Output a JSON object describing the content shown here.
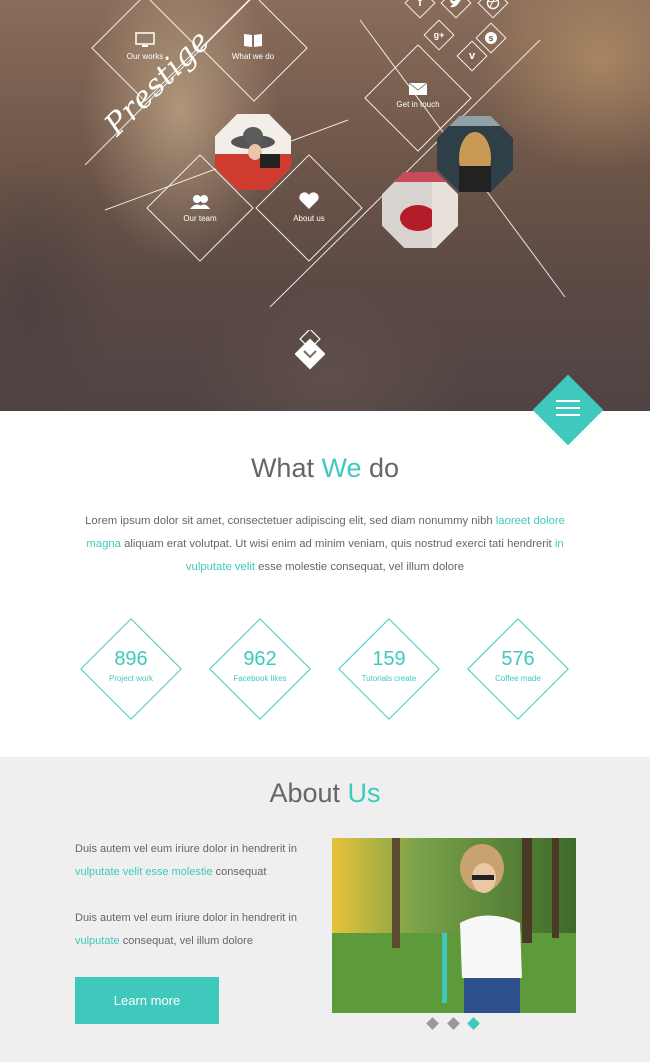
{
  "hero": {
    "brand": "Prestige",
    "tiles": {
      "works": "Our works",
      "what": "What we do",
      "team": "Our team",
      "about": "About us",
      "contact": "Get in touch"
    },
    "social": [
      "facebook-icon",
      "twitter-icon",
      "dribbble-icon",
      "google-plus-icon",
      "skype-icon",
      "vimeo-icon"
    ],
    "social_glyphs": {
      "facebook": "f",
      "google": "g+",
      "vimeo": "v",
      "skype": "s"
    }
  },
  "what_we_do": {
    "title_a": "What ",
    "title_accent": "We",
    "title_b": " do",
    "text_1": "Lorem ipsum dolor sit amet, consectetuer adipiscing elit, sed diam nonummy nibh ",
    "link_1": "laoreet dolore magna",
    "text_2": " aliquam erat volutpat. Ut wisi enim ad minim veniam, quis nostrud exerci tati hendrerit ",
    "link_2": "in vulputate velit",
    "text_3": " esse molestie consequat, vel illum dolore",
    "stats": [
      {
        "value": "896",
        "label": "Project work"
      },
      {
        "value": "962",
        "label": "Facebook likes"
      },
      {
        "value": "159",
        "label": "Tutorials create"
      },
      {
        "value": "576",
        "label": "Coffee made"
      }
    ]
  },
  "about": {
    "title_a": "About ",
    "title_accent": "Us",
    "p1_text": "Duis autem vel eum iriure dolor in hendrerit in ",
    "p1_link": "vulputate velit esse molestie",
    "p1_end": " consequat",
    "p2_text": "Duis autem vel eum iriure dolor in hendrerit in ",
    "p2_link": "vulputate",
    "p2_end": " consequat, vel illum dolore",
    "button": "Learn more",
    "active_slide": 3
  },
  "colors": {
    "accent": "#3fc9bd"
  }
}
